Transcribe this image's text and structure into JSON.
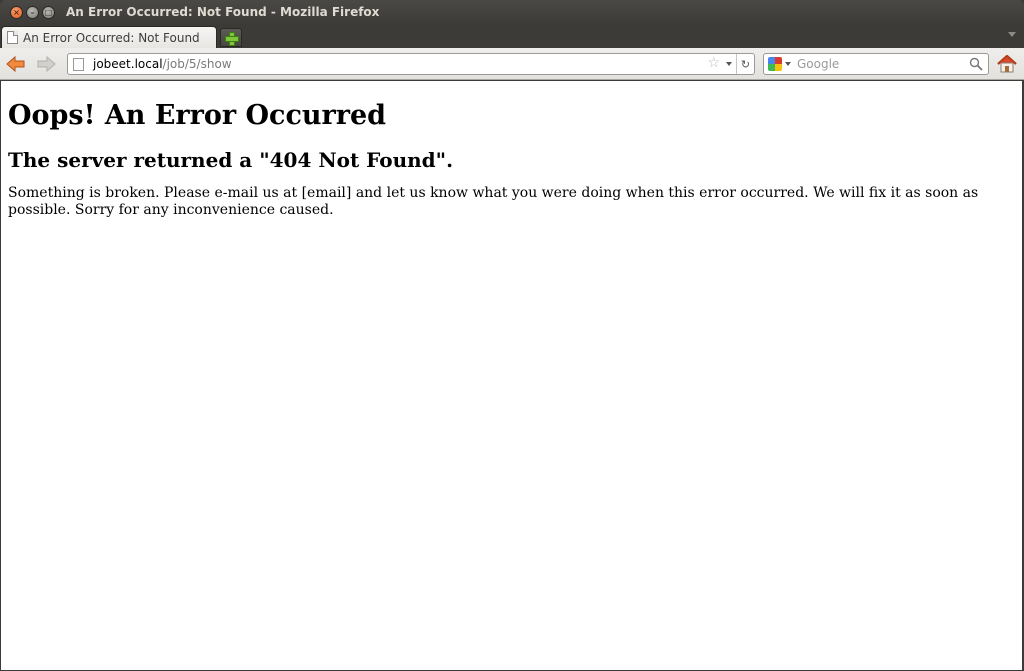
{
  "window": {
    "title": "An Error Occurred: Not Found - Mozilla Firefox",
    "controls": {
      "close": "×",
      "minimize": "–",
      "maximize": "□"
    }
  },
  "tabs": [
    {
      "label": "An Error Occurred: Not Found",
      "active": true
    }
  ],
  "navbar": {
    "url_host": "jobeet.local",
    "url_path": "/job/5/show",
    "reload_glyph": "↻",
    "star_glyph": "☆",
    "search": {
      "engine": "Google",
      "placeholder": "Google",
      "value": ""
    }
  },
  "page": {
    "heading": "Oops! An Error Occurred",
    "subheading": "The server returned a \"404 Not Found\".",
    "message": "Something is broken. Please e-mail us at [email] and let us know what you were doing when this error occurred. We will fix it as soon as possible. Sorry for any inconvenience caused."
  },
  "colors": {
    "titlebar": "#3c3b37",
    "close_button": "#e25a1c",
    "new_tab_plus": "#7dc73b",
    "home_roof": "#d84a2a"
  },
  "icons": [
    "close-icon",
    "minimize-icon",
    "maximize-icon",
    "page-icon",
    "new-tab-plus-icon",
    "back-arrow-icon",
    "forward-arrow-icon",
    "bookmark-star-icon",
    "dropdown-icon",
    "reload-icon",
    "google-logo-icon",
    "search-magnifier-icon",
    "home-icon"
  ]
}
